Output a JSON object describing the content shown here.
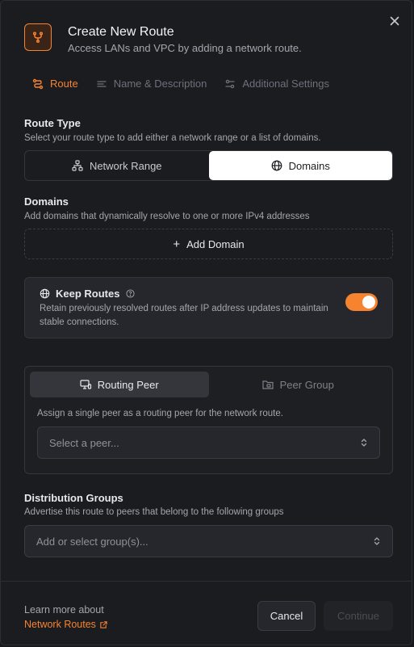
{
  "dialog": {
    "title": "Create New Route",
    "subtitle": "Access LANs and VPC by adding a network route."
  },
  "steps": [
    {
      "label": "Route",
      "icon": "route-icon",
      "active": true
    },
    {
      "label": "Name & Description",
      "icon": "text-lines-icon",
      "active": false
    },
    {
      "label": "Additional Settings",
      "icon": "settings-sliders-icon",
      "active": false
    }
  ],
  "route_type": {
    "title": "Route Type",
    "description": "Select your route type to add either a network range or a list of domains.",
    "options": [
      {
        "label": "Network Range",
        "icon": "network-icon",
        "selected": false
      },
      {
        "label": "Domains",
        "icon": "globe-icon",
        "selected": true
      }
    ]
  },
  "domains": {
    "title": "Domains",
    "description": "Add domains that dynamically resolve to one or more IPv4 addresses",
    "add_label": "Add Domain"
  },
  "keep_routes": {
    "title": "Keep Routes",
    "description": "Retain previously resolved routes after IP address updates to maintain stable connections.",
    "enabled": true
  },
  "peer": {
    "tabs": [
      {
        "label": "Routing Peer",
        "icon": "routing-peer-icon",
        "active": true
      },
      {
        "label": "Peer Group",
        "icon": "peer-group-icon",
        "active": false
      }
    ],
    "description": "Assign a single peer as a routing peer for the network route.",
    "placeholder": "Select a peer..."
  },
  "distribution": {
    "title": "Distribution Groups",
    "description": "Advertise this route to peers that belong to the following groups",
    "placeholder": "Add or select group(s)..."
  },
  "footer": {
    "learn_text": "Learn more about",
    "learn_link": "Network Routes",
    "cancel_label": "Cancel",
    "continue_label": "Continue"
  },
  "colors": {
    "accent": "#f68330",
    "background": "#1b1c20",
    "panel": "#25272c"
  }
}
